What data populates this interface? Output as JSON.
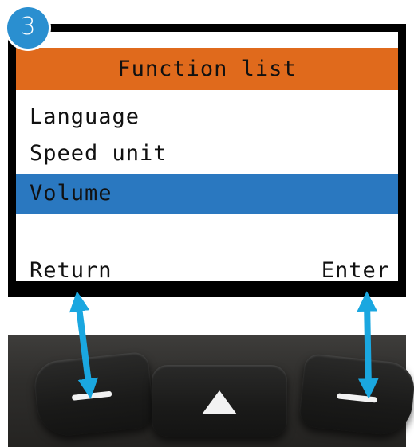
{
  "step": {
    "number": "3",
    "color": "#2a8fd0"
  },
  "screen": {
    "title": "Function list",
    "title_color": "#e06a1c",
    "highlight_color": "#2a78c0",
    "items": [
      {
        "label": "Language",
        "selected": false
      },
      {
        "label": "Speed unit",
        "selected": false
      },
      {
        "label": "Volume",
        "selected": true
      }
    ],
    "softkeys": {
      "left": "Return",
      "right": "Enter"
    }
  },
  "keypad": {
    "keys": [
      {
        "name": "left-soft-key",
        "icon": "dash-icon"
      },
      {
        "name": "up-key",
        "icon": "up-triangle-icon"
      },
      {
        "name": "right-soft-key",
        "icon": "dash-icon"
      }
    ],
    "arrow_color": "#1aa7e0"
  }
}
